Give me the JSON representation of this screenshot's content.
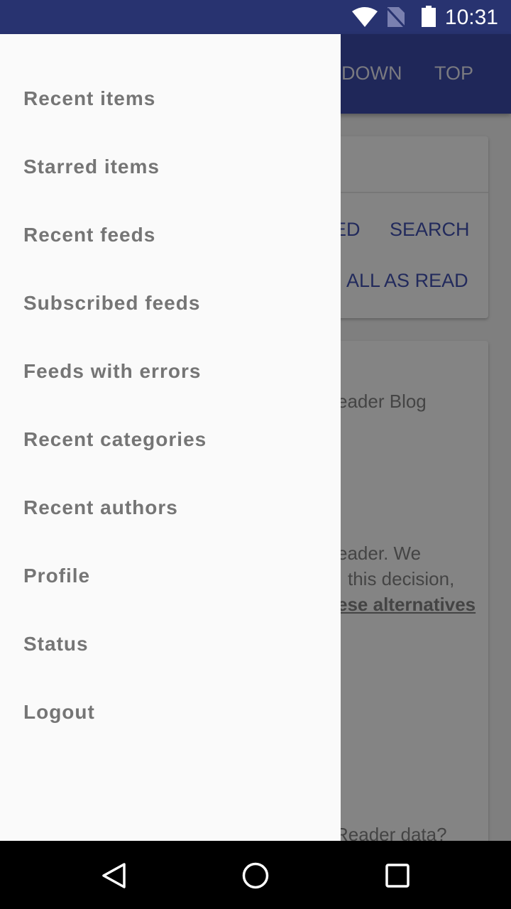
{
  "status_bar": {
    "time": "10:31",
    "icons": [
      "wifi-icon",
      "no-sim-icon",
      "battery-icon"
    ]
  },
  "app_bar": {
    "actions": [
      "DOWN",
      "TOP"
    ]
  },
  "card_actions": {
    "buttons": [
      "ED",
      "SEARCH",
      "ALL AS READ"
    ]
  },
  "card_content": {
    "title": "eader Blog",
    "line1": "eader. We",
    "line2": "this decision,",
    "link": "ese alternatives",
    "bottom": "Reader data?"
  },
  "drawer": {
    "items": [
      {
        "label": "Recent items"
      },
      {
        "label": "Starred items"
      },
      {
        "label": "Recent feeds"
      },
      {
        "label": "Subscribed feeds"
      },
      {
        "label": "Feeds with errors"
      },
      {
        "label": "Recent categories"
      },
      {
        "label": "Recent authors"
      },
      {
        "label": "Profile"
      },
      {
        "label": "Status"
      },
      {
        "label": "Logout"
      }
    ]
  },
  "nav_bar": {
    "icons": [
      "back-icon",
      "home-icon",
      "recents-icon"
    ]
  }
}
